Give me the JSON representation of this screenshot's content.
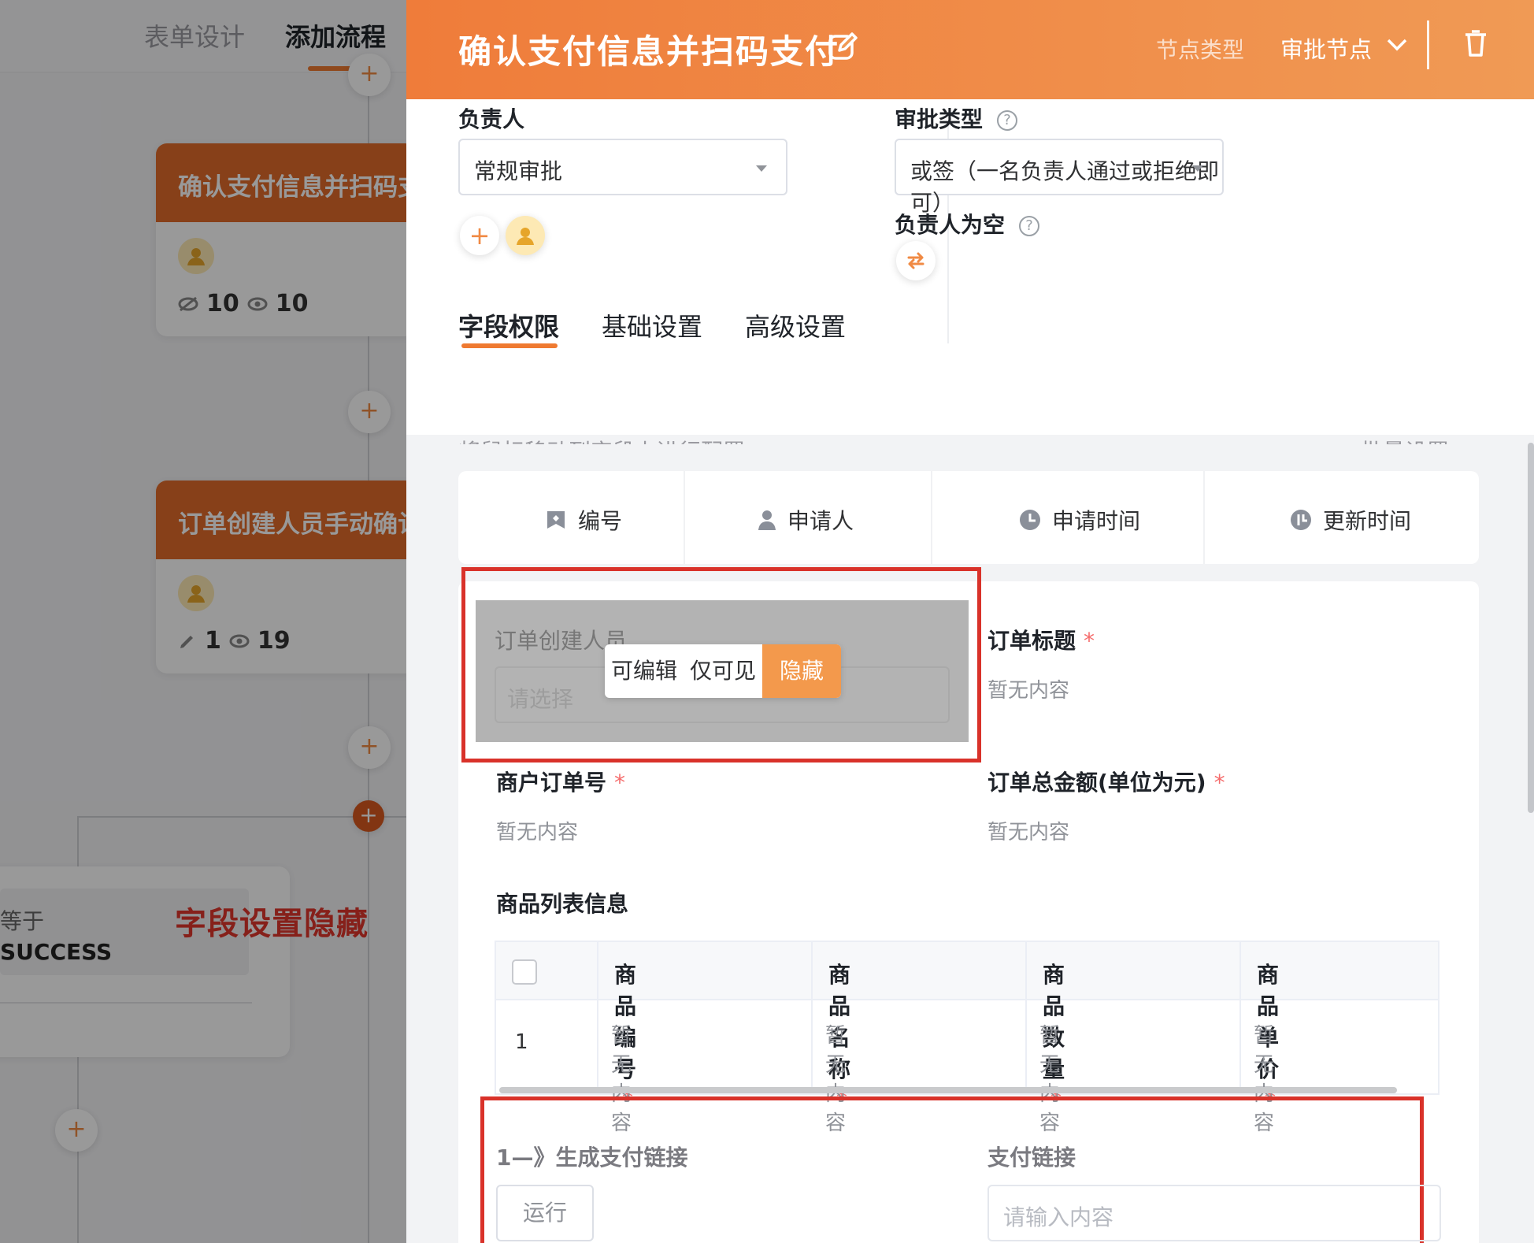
{
  "left_panel": {
    "tabs": [
      {
        "label": "表单设计",
        "active": false
      },
      {
        "label": "添加流程",
        "active": true
      }
    ],
    "nodes": [
      {
        "title": "确认支付信息并扫码支付",
        "meta_icon_1": "eye-off-icon",
        "count_1": "10",
        "meta_icon_2": "eye-icon",
        "count_2": "10"
      },
      {
        "title": "订单创建人员手动确认",
        "meta_icon_1": "pencil-icon",
        "count_1": "1",
        "meta_icon_2": "eye-icon",
        "count_2": "19"
      }
    ],
    "plus_label": "+",
    "condition": {
      "line1": "等于",
      "line2": "SUCCESS"
    },
    "annotation": "字段设置隐藏"
  },
  "drawer": {
    "title": "确认支付信息并扫码支付",
    "node_type_label": "节点类型",
    "node_type_value": "审批节点",
    "owner": {
      "label": "负责人",
      "select_value": "常规审批",
      "add_label": "+"
    },
    "approval_type": {
      "label": "审批类型",
      "help": "?",
      "select_value": "或签（一名负责人通过或拒绝即可）"
    },
    "owner_empty": {
      "label": "负责人为空",
      "help": "?"
    },
    "tabs": [
      {
        "label": "字段权限",
        "active": true
      },
      {
        "label": "基础设置",
        "active": false
      },
      {
        "label": "高级设置",
        "active": false
      }
    ],
    "ghost_hint": "将鼠标移动到字段上进行配置",
    "ghost_batch": "批量设置",
    "system_fields": [
      {
        "label": "编号",
        "icon": "id-card-icon"
      },
      {
        "label": "申请人",
        "icon": "person-icon"
      },
      {
        "label": "申请时间",
        "icon": "clock-icon"
      },
      {
        "label": "更新时间",
        "icon": "history-icon"
      }
    ],
    "fields": {
      "order_creator": {
        "label": "订单创建人员",
        "placeholder": "请选择"
      },
      "permission_options": [
        "可编辑",
        "仅可见",
        "隐藏"
      ],
      "permission_selected": "隐藏",
      "order_title": {
        "label": "订单标题",
        "required": "*",
        "value": "暂无内容"
      },
      "merchant_order_no": {
        "label": "商户订单号",
        "required": "*",
        "value": "暂无内容"
      },
      "order_total": {
        "label": "订单总金额(单位为元)",
        "required": "*",
        "value": "暂无内容"
      },
      "product_list_title": "商品列表信息",
      "product_table": {
        "columns": [
          "商品编号",
          "商品名称",
          "商品数量",
          "商品单价"
        ],
        "required_mark": "*",
        "row_index": "1",
        "cells": [
          "暂无内容",
          "暂无内容",
          "暂无内容",
          "暂无内容"
        ]
      },
      "gen_link": {
        "label": "1—》生成支付链接",
        "button": "运行"
      },
      "pay_link": {
        "label": "支付链接",
        "placeholder": "请输入内容"
      }
    }
  },
  "colors": {
    "accent": "#ef7a31",
    "header_gradient_end": "#f09a55",
    "annotation_red": "#d9322a",
    "required": "#f56c6c"
  }
}
